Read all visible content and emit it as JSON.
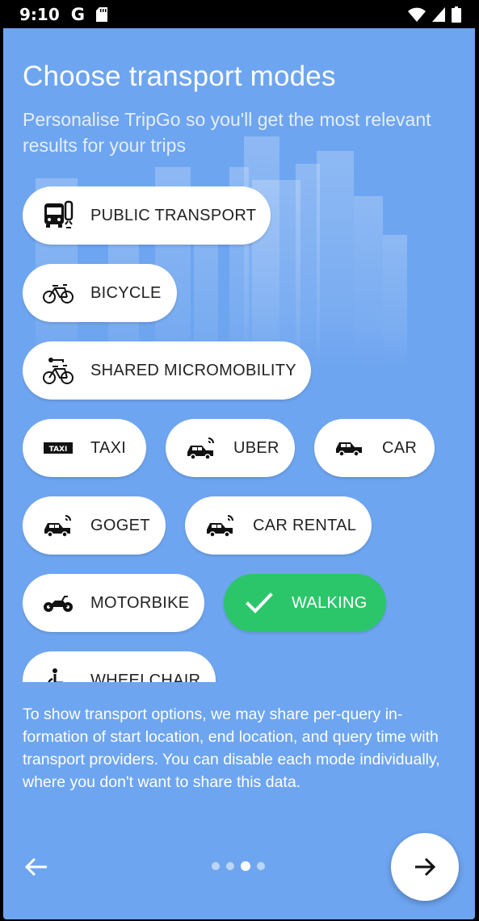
{
  "status_bar": {
    "time": "9:10",
    "icons": [
      "google-g-icon",
      "sd-card-icon",
      "wifi-icon",
      "signal-icon",
      "battery-icon"
    ]
  },
  "header": {
    "title": "Choose transport modes",
    "subtitle": "Personalise TripGo so you'll get the most relevant results for your trips"
  },
  "modes": [
    {
      "label": "PUBLIC TRANSPORT",
      "icon": "bus-icon",
      "selected": false
    },
    {
      "label": "BICYCLE",
      "icon": "bicycle-icon",
      "selected": false
    },
    {
      "label": "SHARED MICROMOBILITY",
      "icon": "shared-bicycle-icon",
      "selected": false
    },
    {
      "label": "TAXI",
      "icon": "taxi-icon",
      "selected": false
    },
    {
      "label": "UBER",
      "icon": "connected-car-icon",
      "selected": false
    },
    {
      "label": "CAR",
      "icon": "car-icon",
      "selected": false
    },
    {
      "label": "GOGET",
      "icon": "connected-car-icon",
      "selected": false
    },
    {
      "label": "CAR RENTAL",
      "icon": "connected-car-icon",
      "selected": false
    },
    {
      "label": "MOTORBIKE",
      "icon": "motorbike-icon",
      "selected": false
    },
    {
      "label": "WALKING",
      "icon": "check-icon",
      "selected": true
    },
    {
      "label": "WHEELCHAIR",
      "icon": "wheelchair-icon",
      "selected": false
    }
  ],
  "info_text": "To show transport options, we may share per-query in-formation of start location, end location, and query time with transport providers. You can disable each mode individually, where you don't want to share this data.",
  "pager": {
    "total": 4,
    "current": 3
  },
  "colors": {
    "background": "#6ea5f0",
    "selected": "#2bc66a",
    "chip": "#ffffff"
  }
}
